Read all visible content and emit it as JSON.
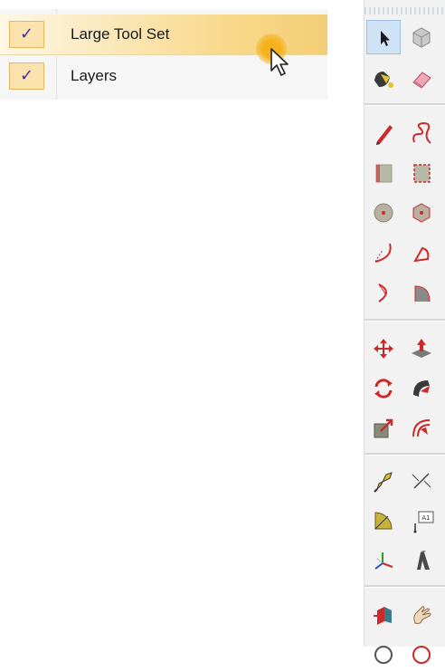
{
  "context_menu": {
    "items": [
      {
        "label": "Large Tool Set",
        "checked": true,
        "check_glyph": "✓",
        "highlighted": true
      },
      {
        "label": "Layers",
        "checked": true,
        "check_glyph": "✓",
        "highlighted": false
      }
    ]
  },
  "cursor": {
    "icon": "arrow-pointer-icon"
  },
  "toolbar": {
    "name": "Large Tool Set",
    "selected_tool": "select",
    "tools": [
      "select",
      "component",
      "paint-bucket",
      "eraser",
      "pencil",
      "freehand",
      "rectangle",
      "rotated-rectangle",
      "circle",
      "polygon",
      "arc",
      "pie",
      "two-point-arc",
      "three-point-arc",
      "move",
      "push-pull",
      "rotate",
      "follow-me",
      "scale",
      "offset",
      "tape-measure",
      "dimension",
      "protractor",
      "text",
      "axes",
      "3d-text",
      "section-plane",
      "walk"
    ],
    "dimension_icon_text": "A1",
    "text_icon_text": "A1"
  },
  "colors": {
    "menu_highlight": "#f8d88a",
    "check_box_fill": "#fbe3ad",
    "check_mark": "#3b2fa6",
    "tool_red": "#cc2a2a",
    "selected_tool_bg": "#cfe2f6"
  }
}
